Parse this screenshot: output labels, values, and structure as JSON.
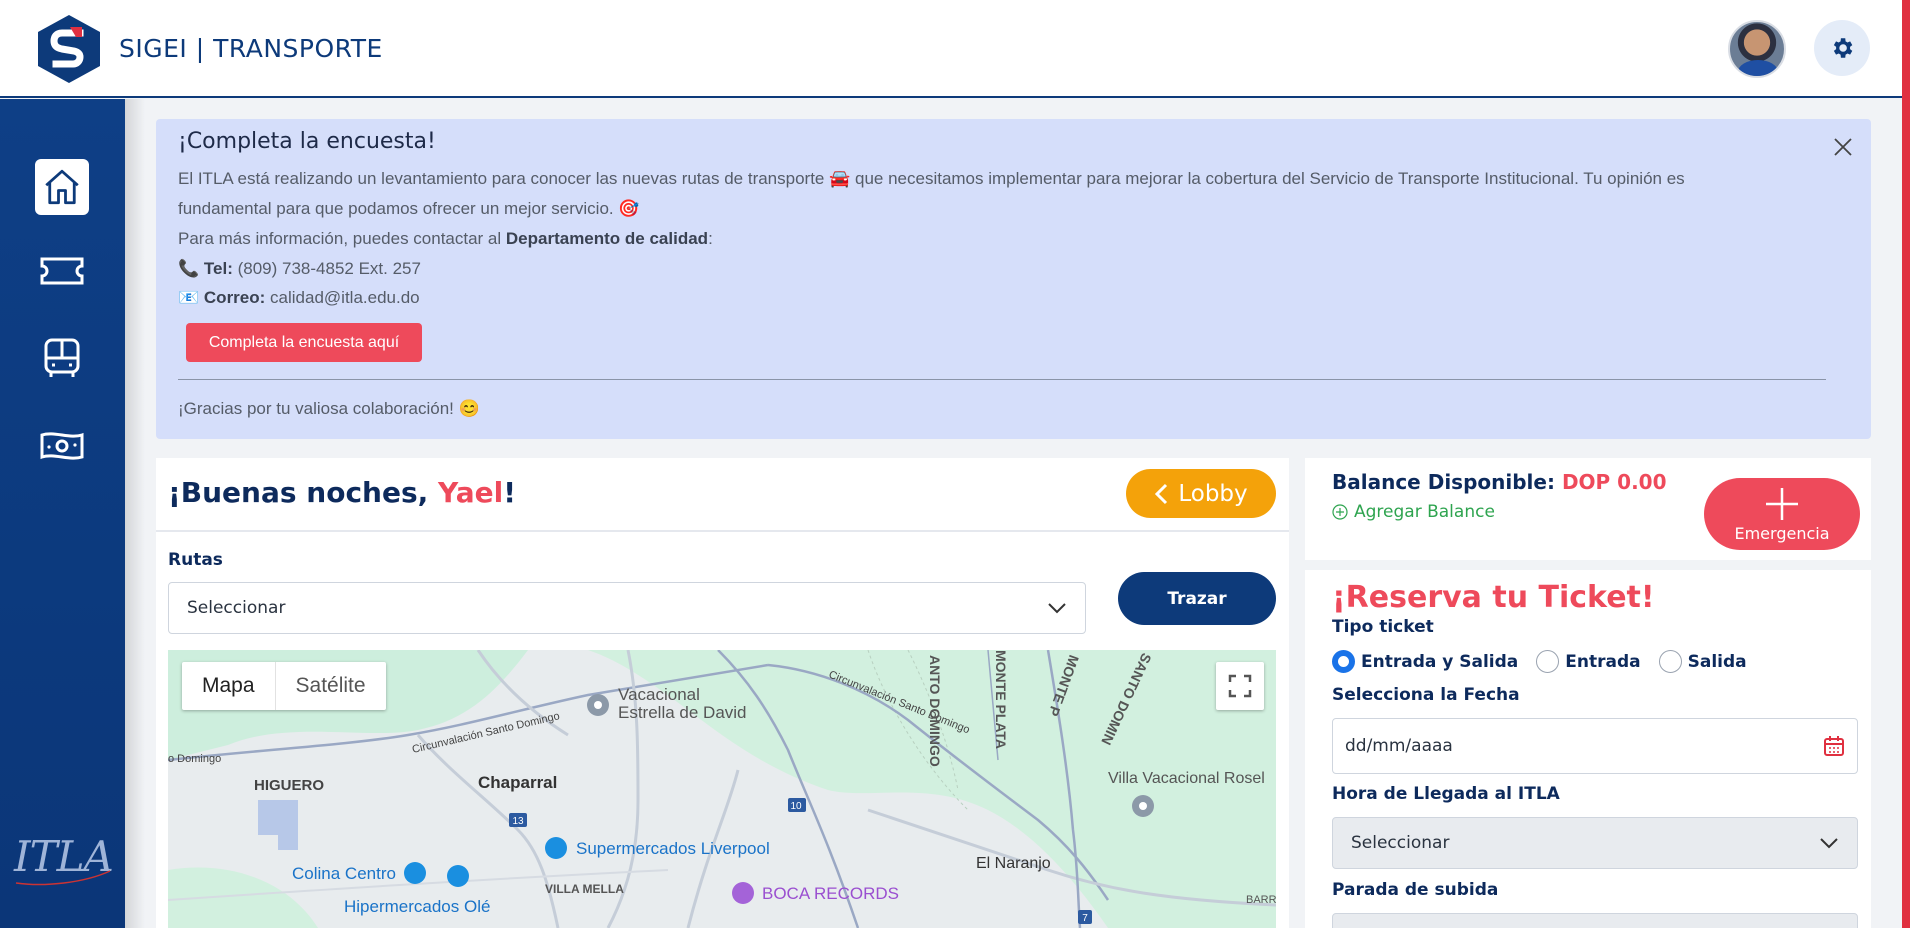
{
  "app": {
    "title": "SIGEI | TRANSPORTE"
  },
  "banner": {
    "title": "¡Completa la encuesta!",
    "paragraph": "El ITLA está realizando un levantamiento para conocer las nuevas rutas de transporte 🚘 que necesitamos implementar para mejorar la cobertura del Servicio de Transporte Institucional. Tu opinión es",
    "paragraph2": "fundamental para que podamos ofrecer un mejor servicio. 🎯",
    "info_prefix": "Para más información, puedes contactar al ",
    "info_dept": "Departamento de calidad",
    "info_suffix": ":",
    "tel_label": "Tel:",
    "tel_value": " (809) 738-4852 Ext. 257",
    "mail_label": "Correo:",
    "mail_value": " calidad@itla.edu.do",
    "cta_label": "Completa la encuesta aquí",
    "thanks": "¡Gracias por tu valiosa colaboración! 😊"
  },
  "greeting": {
    "prefix": "¡Buenas noches, ",
    "name": "Yael",
    "suffix": "!"
  },
  "lobby_label": "Lobby",
  "routes": {
    "label": "Rutas",
    "selected": "Seleccionar",
    "trace_label": "Trazar"
  },
  "map": {
    "tab_map": "Mapa",
    "tab_satellite": "Satélite",
    "labels": {
      "vacacional": "Vacacional",
      "estrella": "Estrella de David",
      "circ1": "Circunvalación Santo Domingo",
      "circ2": "Circunvalación Santo Domingo",
      "circ3": "Circunvalación Santo Domingo",
      "higuero": "HIGUERO",
      "chaparral": "Chaparral",
      "santo_domingo_v": "ANTO DOMINGO",
      "monte_plata": "MONTE PLATA",
      "monte_p": "MONTE P",
      "santo_domin": "SANTO DOMIN",
      "villa_rosel": "Villa Vacacional Rosel",
      "liverpool": "Supermercados Liverpool",
      "colina": "Colina Centro",
      "hiper": "Hipermercados Olé",
      "villa_mella": "VILLA MELLA",
      "boca": "BOCA RECORDS",
      "naranjo": "El Naranjo",
      "barr": "BARR",
      "o_domingo": "o Domingo",
      "r10": "10",
      "r13": "13",
      "r7": "7"
    }
  },
  "balance": {
    "label": "Balance Disponible:",
    "value": "DOP 0.00",
    "add_label": "Agregar Balance",
    "emergency_label": "Emergencia"
  },
  "reservation": {
    "title": "¡Reserva tu Ticket!",
    "ticket_type_label": "Tipo ticket",
    "options": [
      "Entrada y Salida",
      "Entrada",
      "Salida"
    ],
    "selected_option": "Entrada y Salida",
    "date_label": "Selecciona la Fecha",
    "date_placeholder": "dd/mm/aaaa",
    "arrival_label": "Hora de Llegada al ITLA",
    "arrival_selected": "Seleccionar",
    "stop_label": "Parada de subida"
  },
  "sidebar": {
    "logo_text": "ITLA",
    "items": [
      "home",
      "tickets",
      "bus",
      "money"
    ]
  },
  "colors": {
    "primary": "#0d3a7a",
    "accent": "#ee4a5b",
    "lobby": "#f4a20a",
    "success": "#2ea44f",
    "banner_bg": "#d5defa"
  }
}
